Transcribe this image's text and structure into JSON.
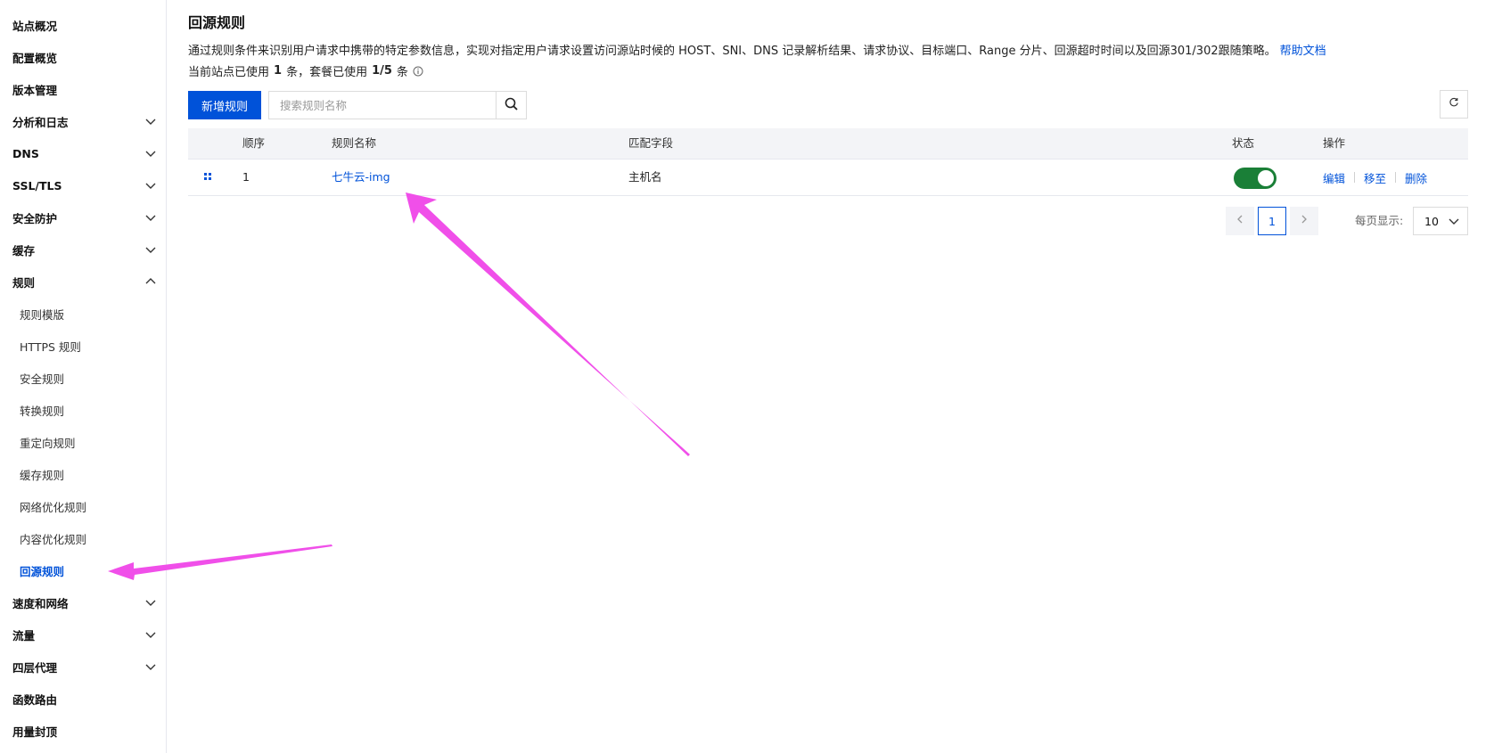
{
  "sidebar": {
    "items": [
      {
        "label": "站点概况",
        "chevron": "none"
      },
      {
        "label": "配置概览",
        "chevron": "none"
      },
      {
        "label": "版本管理",
        "chevron": "none"
      },
      {
        "label": "分析和日志",
        "chevron": "down"
      },
      {
        "label": "DNS",
        "chevron": "down"
      },
      {
        "label": "SSL/TLS",
        "chevron": "down"
      },
      {
        "label": "安全防护",
        "chevron": "down"
      },
      {
        "label": "缓存",
        "chevron": "down"
      },
      {
        "label": "规则",
        "chevron": "up"
      },
      {
        "label": "规则模版",
        "chevron": "none"
      },
      {
        "label": "HTTPS 规则",
        "chevron": "none"
      },
      {
        "label": "安全规则",
        "chevron": "none"
      },
      {
        "label": "转换规则",
        "chevron": "none"
      },
      {
        "label": "重定向规则",
        "chevron": "none"
      },
      {
        "label": "缓存规则",
        "chevron": "none"
      },
      {
        "label": "网络优化规则",
        "chevron": "none"
      },
      {
        "label": "内容优化规则",
        "chevron": "none"
      },
      {
        "label": "回源规则",
        "chevron": "none"
      },
      {
        "label": "速度和网络",
        "chevron": "down"
      },
      {
        "label": "流量",
        "chevron": "down"
      },
      {
        "label": "四层代理",
        "chevron": "down"
      },
      {
        "label": "函数路由",
        "chevron": "none"
      },
      {
        "label": "用量封顶",
        "chevron": "none"
      }
    ]
  },
  "header": {
    "title": "回源规则",
    "description": "通过规则条件来识别用户请求中携带的特定参数信息，实现对指定用户请求设置访问源站时候的 HOST、SNI、DNS 记录解析结果、请求协议、目标端口、Range 分片、回源超时时间以及回源301/302跟随策略。",
    "help_link": "帮助文档",
    "usage_prefix": "当前站点已使用",
    "usage_count": "1",
    "usage_mid": "条，套餐已使用",
    "usage_quota": "1/5",
    "usage_suffix": "条"
  },
  "toolbar": {
    "add_label": "新增规则",
    "search_placeholder": "搜索规则名称"
  },
  "table": {
    "columns": {
      "order": "顺序",
      "name": "规则名称",
      "match": "匹配字段",
      "status": "状态",
      "actions": "操作"
    },
    "rows": [
      {
        "order": "1",
        "name": "七牛云-img",
        "match": "主机名",
        "enabled": true,
        "actions": {
          "edit": "编辑",
          "move": "移至",
          "delete": "删除"
        }
      }
    ]
  },
  "pagination": {
    "current_page": "1",
    "page_size_label": "每页显示:",
    "page_size": "10"
  },
  "colors": {
    "primary": "#0052d9",
    "toggle_on": "#1a7f37",
    "annotation_arrow": "#f04fe9"
  }
}
